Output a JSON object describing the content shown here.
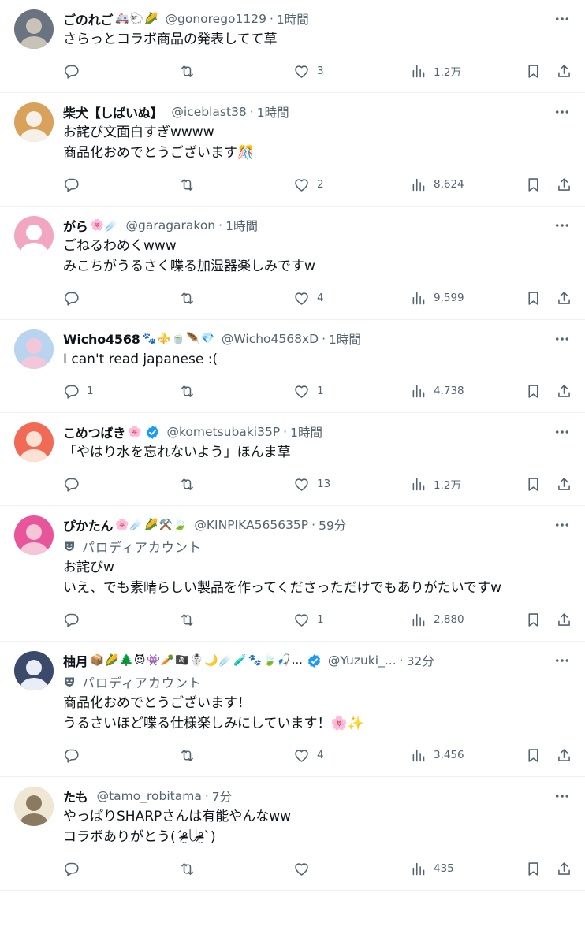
{
  "colors": {
    "text": "#0f1419",
    "secondary": "#536471",
    "divider": "#eff3f4",
    "verified": "#1d9bf0"
  },
  "tweets": [
    {
      "name": "ごのれご",
      "emojis": "🚑🐑🌽",
      "verified": false,
      "handle": "@gonorego1129",
      "time": "1時間",
      "parody": false,
      "parody_label": "",
      "text": "さらっとコラボ商品の発表してて草",
      "replies": "",
      "likes": "3",
      "views": "1.2万",
      "avatar_colors": [
        "#6a7480",
        "#c9c2b6"
      ]
    },
    {
      "name": "柴犬【しばいぬ】",
      "emojis": "",
      "verified": false,
      "handle": "@iceblast38",
      "time": "1時間",
      "parody": false,
      "parody_label": "",
      "text": "お詫び文面白すぎwwww\n商品化おめでとうございます🎊",
      "replies": "",
      "likes": "2",
      "views": "8,624",
      "avatar_colors": [
        "#d9a25a",
        "#f6f1e8"
      ]
    },
    {
      "name": "がら",
      "emojis": "🌸☄️",
      "verified": false,
      "handle": "@garagarakon",
      "time": "1時間",
      "parody": false,
      "parody_label": "",
      "text": "ごねるわめくwww\nみこちがうるさく喋る加湿器楽しみですw",
      "replies": "",
      "likes": "4",
      "views": "9,599",
      "avatar_colors": [
        "#f3a6bf",
        "#ffffff"
      ]
    },
    {
      "name": "Wicho4568",
      "emojis": "🐾⚜️🍵🪶💎",
      "verified": false,
      "handle": "@Wicho4568xD",
      "time": "1時間",
      "parody": false,
      "parody_label": "",
      "text": "I can't read japanese :(",
      "replies": "1",
      "likes": "1",
      "views": "4,738",
      "avatar_colors": [
        "#b8d4ee",
        "#f2c7da"
      ]
    },
    {
      "name": "こめつばき",
      "emojis": "🌸",
      "verified": true,
      "handle": "@kometsubaki35P",
      "time": "1時間",
      "parody": false,
      "parody_label": "",
      "text": "「やはり水を忘れないよう」ほんま草",
      "replies": "",
      "likes": "13",
      "views": "1.2万",
      "avatar_colors": [
        "#f06a55",
        "#fde2d4"
      ]
    },
    {
      "name": "ぴかたん",
      "emojis": "🌸☄️🌽⚒️🍃",
      "verified": false,
      "handle": "@KINPIKA565635P",
      "time": "59分",
      "parody": true,
      "parody_label": "パロディアカウント",
      "text": "お詫びw\nいえ、でも素晴らしい製品を作ってくださっただけでもありがたいですw",
      "replies": "",
      "likes": "1",
      "views": "2,880",
      "avatar_colors": [
        "#e8559a",
        "#f7c5d8"
      ]
    },
    {
      "name": "柚月",
      "emojis": "📦🌽🌲😈👾🥕🏴‍☠️☃️🌙☄️🧪🐾🍃🎣…",
      "verified": true,
      "handle": "@Yuzuki_...",
      "time": "32分",
      "parody": true,
      "parody_label": "パロディアカウント",
      "text": "商品化おめでとうございます！\nうるさいほど喋る仕様楽しみにしています！🌸✨",
      "replies": "",
      "likes": "4",
      "views": "3,456",
      "avatar_colors": [
        "#3b4a6b",
        "#e9edf5"
      ]
    },
    {
      "name": "たも",
      "emojis": "",
      "verified": false,
      "handle": "@tamo_robitama",
      "time": "7分",
      "parody": false,
      "parody_label": "",
      "text": "やっぱりSHARPさんは有能やんなww\nコラボありがとう(ˊᵒ̴̶̷̤ꇴᵒ̴̶̷̤ˋ)",
      "replies": "",
      "likes": "",
      "views": "435",
      "avatar_colors": [
        "#efe6d4",
        "#8a7a62"
      ]
    }
  ]
}
